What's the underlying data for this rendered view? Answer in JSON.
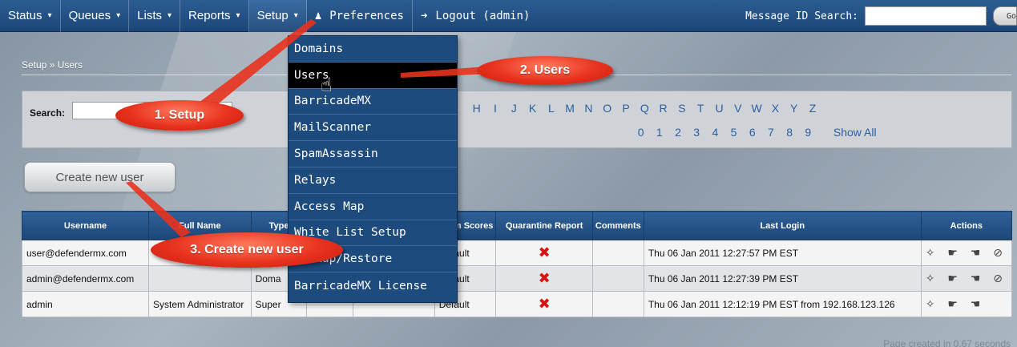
{
  "nav": {
    "items": [
      {
        "label": "Status",
        "caret": "▾"
      },
      {
        "label": "Queues",
        "caret": "▾"
      },
      {
        "label": "Lists",
        "caret": "▾"
      },
      {
        "label": "Reports",
        "caret": "▾"
      },
      {
        "label": "Setup",
        "caret": "▾"
      }
    ],
    "preferences": "Preferences",
    "preferences_icon": "user-icon",
    "logout": "Logout (admin)",
    "logout_icon": "arrow-right-icon",
    "message_search_label": "Message ID Search:",
    "go_label": "Go"
  },
  "breadcrumb": "Setup » Users",
  "search": {
    "label": "Search:",
    "letters": [
      "H",
      "I",
      "J",
      "K",
      "L",
      "M",
      "N",
      "O",
      "P",
      "Q",
      "R",
      "S",
      "T",
      "U",
      "V",
      "W",
      "X",
      "Y",
      "Z"
    ],
    "digits": [
      "0",
      "1",
      "2",
      "3",
      "4",
      "5",
      "6",
      "7",
      "8",
      "9"
    ],
    "show_all": "Show All"
  },
  "create_button": "Create new user",
  "table": {
    "headers": [
      "Username",
      "Full Name",
      "Type",
      "",
      "",
      "Spam Scores",
      "Quarantine Report",
      "Comments",
      "Last Login",
      "Actions"
    ],
    "rows": [
      {
        "username": "user@defendermx.com",
        "fullname": "",
        "type": "",
        "scores": "Default",
        "quarantine": "✖",
        "comments": "",
        "last_login": "Thu 06 Jan 2011 12:27:57 PM EST",
        "actions": "✧ ☛ ☚ ⊘"
      },
      {
        "username": "admin@defendermx.com",
        "fullname": "",
        "type": "Doma",
        "scores": "Default",
        "quarantine": "✖",
        "comments": "",
        "last_login": "Thu 06 Jan 2011 12:27:39 PM EST",
        "actions": "✧ ☛ ☚ ⊘"
      },
      {
        "username": "admin",
        "fullname": "System Administrator",
        "type": "Super",
        "scores": "Default",
        "quarantine": "✖",
        "comments": "",
        "last_login": "Thu 06 Jan 2011 12:12:19 PM EST from 192.168.123.126",
        "actions": "✧ ☛ ☚"
      }
    ]
  },
  "footer_note": "Page created in 0.67 seconds",
  "dropdown": {
    "items": [
      "Domains",
      "Users",
      "BarricadeMX",
      "MailScanner",
      "SpamAssassin",
      "Relays",
      "Access Map",
      "White List Setup",
      "Backup/Restore",
      "BarricadeMX License"
    ],
    "hovered": "Users"
  },
  "callouts": {
    "setup": "1. Setup",
    "users": "2. Users",
    "create": "3. Create new user"
  },
  "colors": {
    "nav_bg": "#1c4677",
    "callout_red": "#e8321e",
    "link_blue": "#2a5ea0"
  }
}
